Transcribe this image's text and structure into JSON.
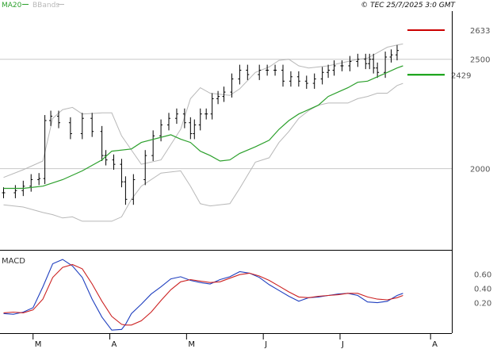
{
  "header": {
    "legend": [
      {
        "label": "MA20",
        "color": "#2ca02c"
      },
      {
        "label": "BBands",
        "color": "#b8b8b8"
      }
    ],
    "timestamp": "© TEC 25/7/2025 3:0 GMT"
  },
  "chart_data": [
    {
      "type": "line",
      "panel": "price",
      "y_ticks": [
        {
          "value": 2000,
          "label": "2000"
        },
        {
          "value": 2500,
          "label": "2500"
        }
      ],
      "ylim": [
        1640,
        2720
      ],
      "reference_lines": [
        {
          "name": "last_price",
          "value": 2633,
          "label": "2633",
          "color": "#cc0000"
        },
        {
          "name": "ma20_value",
          "value": 2429,
          "label": "2429",
          "color": "#009900"
        }
      ],
      "series": [
        {
          "name": "MA20",
          "color": "#2ca02c",
          "x": [
            0,
            10,
            20,
            30,
            40,
            50,
            55,
            65,
            70,
            85,
            90,
            95,
            100,
            105,
            110,
            115,
            120,
            128,
            135,
            140,
            145,
            150,
            155,
            160,
            165,
            170,
            175,
            180,
            185,
            190,
            195,
            200,
            203
          ],
          "values": [
            1910,
            1910,
            1920,
            1950,
            1990,
            2040,
            2080,
            2090,
            2120,
            2155,
            2135,
            2120,
            2080,
            2060,
            2035,
            2040,
            2070,
            2100,
            2130,
            2180,
            2220,
            2250,
            2270,
            2290,
            2330,
            2350,
            2370,
            2395,
            2400,
            2420,
            2440,
            2460,
            2470
          ]
        },
        {
          "name": "BBands upper",
          "color": "#b8b8b8",
          "x": [
            0,
            10,
            20,
            25,
            30,
            35,
            40,
            50,
            55,
            60,
            70,
            80,
            90,
            95,
            100,
            105,
            115,
            120,
            128,
            135,
            140,
            145,
            150,
            155,
            160,
            165,
            170,
            175,
            180,
            185,
            190,
            195,
            200,
            203
          ],
          "values": [
            1960,
            1995,
            2035,
            2230,
            2270,
            2280,
            2250,
            2255,
            2255,
            2150,
            2020,
            2040,
            2180,
            2320,
            2370,
            2345,
            2335,
            2365,
            2440,
            2465,
            2495,
            2500,
            2470,
            2460,
            2465,
            2470,
            2480,
            2490,
            2500,
            2505,
            2530,
            2555,
            2565,
            2570
          ]
        },
        {
          "name": "BBands lower",
          "color": "#b8b8b8",
          "x": [
            0,
            10,
            20,
            25,
            30,
            35,
            40,
            50,
            55,
            60,
            65,
            70,
            80,
            90,
            95,
            100,
            105,
            115,
            120,
            128,
            135,
            140,
            145,
            150,
            155,
            160,
            165,
            170,
            175,
            180,
            185,
            190,
            195,
            200,
            203
          ],
          "values": [
            1835,
            1825,
            1800,
            1790,
            1775,
            1780,
            1760,
            1760,
            1760,
            1780,
            1860,
            1920,
            1980,
            1990,
            1920,
            1840,
            1830,
            1840,
            1910,
            2030,
            2050,
            2120,
            2170,
            2230,
            2265,
            2290,
            2300,
            2300,
            2300,
            2320,
            2330,
            2345,
            2345,
            2380,
            2390
          ]
        }
      ],
      "price_bars": {
        "x": [
          0,
          6,
          10,
          14,
          18,
          21,
          24,
          28,
          34,
          40,
          45,
          50,
          52,
          56,
          60,
          62,
          66,
          72,
          76,
          80,
          84,
          88,
          92,
          95,
          97,
          100,
          103,
          106,
          109,
          112,
          116,
          120,
          124,
          130,
          134,
          138,
          142,
          146,
          150,
          154,
          158,
          162,
          165,
          168,
          172,
          176,
          180,
          184,
          186,
          188,
          190,
          194,
          197,
          200
        ],
        "close": [
          1890,
          1900,
          1920,
          1950,
          1955,
          2220,
          2240,
          2210,
          2160,
          2230,
          2170,
          2060,
          2040,
          2020,
          1940,
          1860,
          1950,
          2060,
          2150,
          2200,
          2230,
          2250,
          2210,
          2160,
          2200,
          2250,
          2250,
          2320,
          2330,
          2350,
          2410,
          2450,
          2430,
          2450,
          2450,
          2450,
          2400,
          2420,
          2400,
          2390,
          2410,
          2440,
          2450,
          2470,
          2470,
          2490,
          2500,
          2480,
          2500,
          2460,
          2440,
          2510,
          2520,
          2540
        ]
      }
    },
    {
      "type": "line",
      "panel": "macd",
      "title": "MACD",
      "y_ticks": [
        {
          "value": 0.6,
          "label": "0.60"
        },
        {
          "value": 0.4,
          "label": "0.40"
        },
        {
          "value": 0.2,
          "label": "0.20"
        }
      ],
      "ylim": [
        -0.2,
        0.9
      ],
      "x_ticks": [
        {
          "x": 15,
          "label": "M"
        },
        {
          "x": 54,
          "label": "A"
        },
        {
          "x": 93,
          "label": "M"
        },
        {
          "x": 132,
          "label": "J"
        },
        {
          "x": 171,
          "label": "J"
        },
        {
          "x": 217,
          "label": "A"
        }
      ],
      "xlim": [
        -1,
        227
      ],
      "series": [
        {
          "name": "MACD",
          "color": "#1f3fbf",
          "x": [
            0,
            5,
            10,
            15,
            20,
            25,
            30,
            35,
            40,
            45,
            50,
            55,
            60,
            62,
            65,
            70,
            75,
            80,
            85,
            90,
            95,
            100,
            105,
            110,
            115,
            120,
            125,
            130,
            135,
            140,
            145,
            150,
            155,
            160,
            165,
            170,
            175,
            180,
            185,
            190,
            195,
            200,
            203
          ],
          "values": [
            0.05,
            0.04,
            0.07,
            0.13,
            0.42,
            0.74,
            0.8,
            0.71,
            0.55,
            0.25,
            0.0,
            -0.18,
            -0.17,
            -0.1,
            0.05,
            0.18,
            0.32,
            0.42,
            0.53,
            0.56,
            0.51,
            0.48,
            0.46,
            0.52,
            0.56,
            0.63,
            0.61,
            0.55,
            0.45,
            0.37,
            0.29,
            0.22,
            0.27,
            0.28,
            0.3,
            0.32,
            0.33,
            0.3,
            0.21,
            0.2,
            0.22,
            0.3,
            0.33
          ]
        },
        {
          "name": "Signal",
          "color": "#cc2222",
          "x": [
            0,
            5,
            10,
            15,
            20,
            25,
            30,
            35,
            40,
            45,
            50,
            55,
            60,
            62,
            65,
            70,
            75,
            80,
            85,
            90,
            95,
            100,
            105,
            110,
            115,
            120,
            125,
            130,
            135,
            140,
            145,
            150,
            155,
            160,
            165,
            170,
            175,
            180,
            185,
            190,
            195,
            200,
            203
          ],
          "values": [
            0.06,
            0.07,
            0.06,
            0.1,
            0.25,
            0.55,
            0.69,
            0.73,
            0.67,
            0.46,
            0.22,
            0.01,
            -0.1,
            -0.11,
            -0.11,
            -0.05,
            0.07,
            0.23,
            0.38,
            0.49,
            0.52,
            0.5,
            0.48,
            0.49,
            0.54,
            0.59,
            0.61,
            0.57,
            0.51,
            0.43,
            0.35,
            0.28,
            0.27,
            0.29,
            0.3,
            0.31,
            0.33,
            0.33,
            0.28,
            0.25,
            0.24,
            0.27,
            0.3
          ]
        }
      ]
    }
  ]
}
